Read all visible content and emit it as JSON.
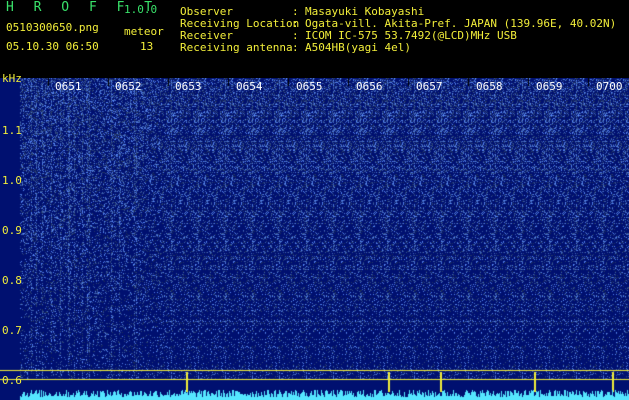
{
  "header": {
    "app_name": "H R O F F T",
    "version": "1.0.0",
    "filename": "0510300650.png",
    "datetime": "05.10.30 06:50",
    "meteor_label": "meteor",
    "meteor_count": "13",
    "fields": [
      {
        "label": "Observer",
        "value": "Masayuki Kobayashi"
      },
      {
        "label": "Receiving Location",
        "value": "Ogata-vill. Akita-Pref. JAPAN (139.96E, 40.02N)"
      },
      {
        "label": "Receiver",
        "value": "ICOM IC-575 53.7492(@LCD)MHz USB"
      },
      {
        "label": "Receiving antenna",
        "value": "A504HB(yagi 4el)"
      }
    ]
  },
  "spectrogram": {
    "y_unit": "kHz",
    "y_ticks": [
      "1.1",
      "1.0",
      "0.9",
      "0.8",
      "0.7",
      "0.6"
    ],
    "x_ticks": [
      "0651",
      "0652",
      "0653",
      "0654",
      "0655",
      "0656",
      "0657",
      "0658",
      "0659",
      "0700"
    ],
    "colors": {
      "background": "#001070",
      "noise": "#3c7cff",
      "trace": "#55e6ff",
      "baseline": "#f2ee3a"
    }
  }
}
